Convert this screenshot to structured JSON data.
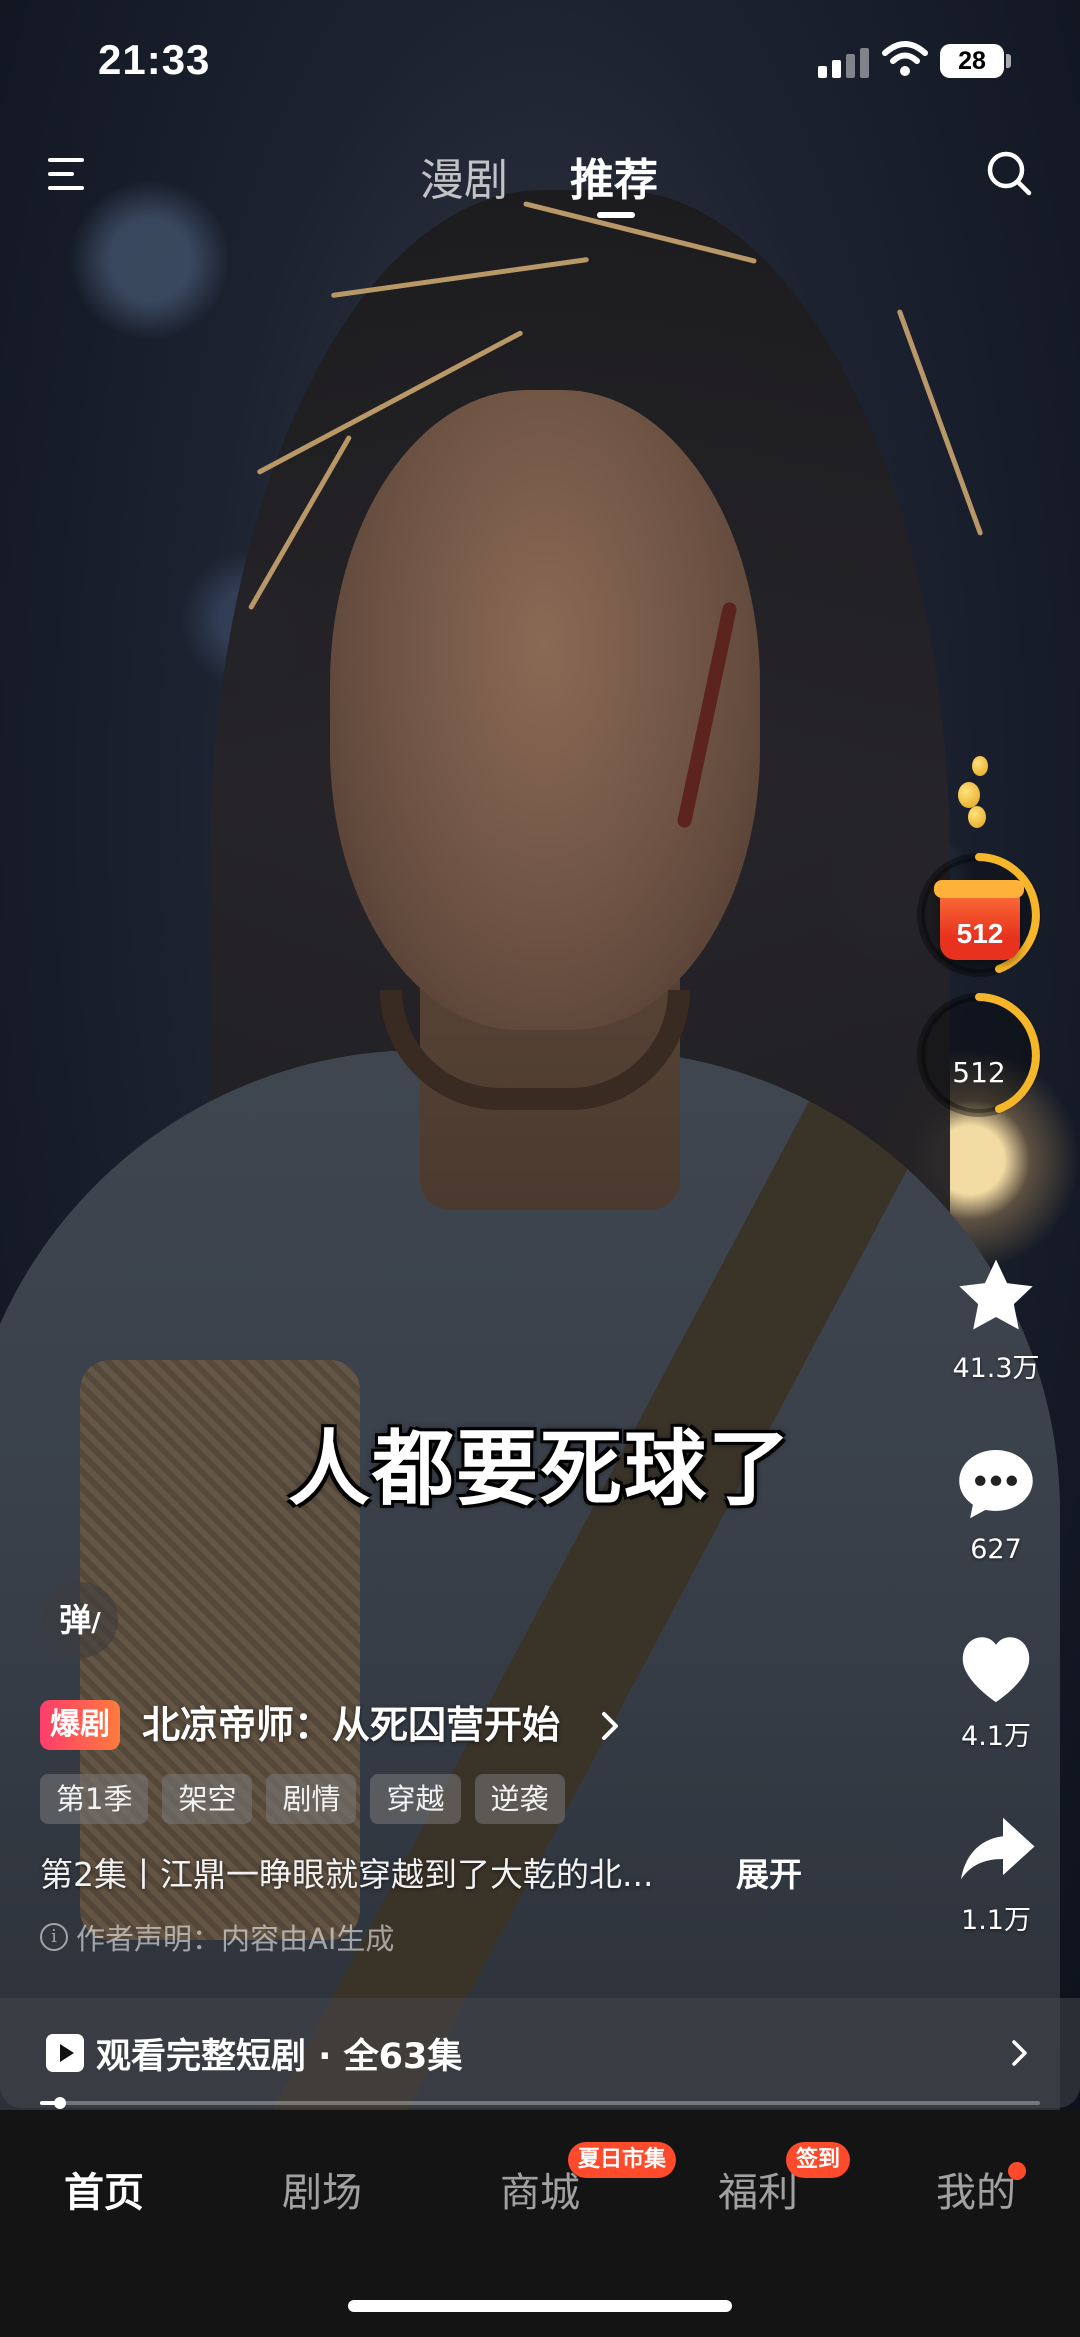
{
  "status_bar": {
    "time": "21:33",
    "battery": "28"
  },
  "top_nav": {
    "tabs": [
      {
        "label": "漫剧"
      },
      {
        "label": "推荐"
      }
    ],
    "active_tab": "推荐"
  },
  "subtitle": "人都要死球了",
  "rail": {
    "reward_amount": "512",
    "counter_value": "512",
    "favorite_count": "41.3万",
    "comment_count": "627",
    "like_count": "4.1万",
    "share_count": "1.1万"
  },
  "info": {
    "danmu_label": "弹",
    "hot_badge": "爆剧",
    "series_title": "北凉帝师：从死囚营开始",
    "tags": [
      "第1季",
      "架空",
      "剧情",
      "穿越",
      "逆袭"
    ],
    "episode_desc": "第2集丨江鼎一睁眼就穿越到了大乾的北...",
    "expand_label": "展开",
    "ai_note": "作者声明：内容由AI生成"
  },
  "full_series": {
    "label": "观看完整短剧 · 全63集",
    "progress": 0.02
  },
  "bottom_nav": {
    "items": [
      {
        "label": "首页"
      },
      {
        "label": "剧场"
      },
      {
        "label": "商城",
        "badge": "夏日市集"
      },
      {
        "label": "福利",
        "badge": "签到"
      },
      {
        "label": "我的"
      }
    ]
  },
  "colors": {
    "accent": "#ff4b2b",
    "reward_ring": "#f5b62a",
    "hot_badge_start": "#ff3d6b",
    "hot_badge_end": "#ff7b3d"
  }
}
